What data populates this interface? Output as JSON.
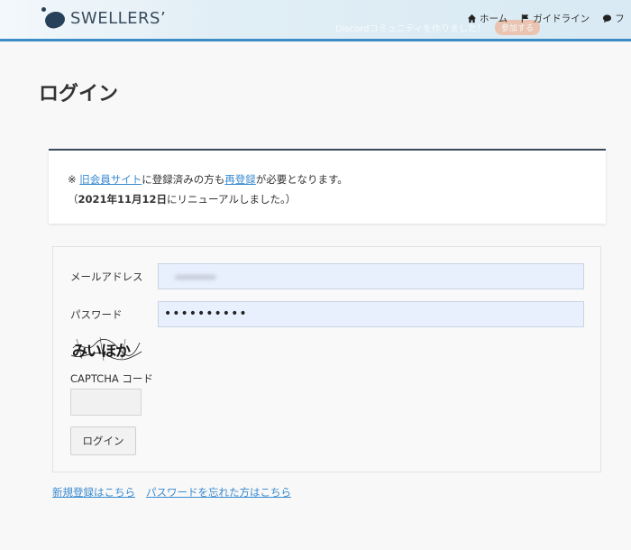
{
  "header": {
    "logo_text": "SWELLERS’",
    "banner_text": "Discordコミュニティを作りました！",
    "banner_button": "参加する",
    "nav": [
      {
        "label": "ホーム",
        "icon": "home-icon"
      },
      {
        "label": "ガイドライン",
        "icon": "flag-icon"
      },
      {
        "label": "フ",
        "icon": "speech-bubble-icon"
      }
    ],
    "accent_color": "#3c8cc8"
  },
  "page_title": "ログイン",
  "notice": {
    "prefix": "※ ",
    "link1": "旧会員サイト",
    "text1": "に登録済みの方も",
    "link2": "再登録",
    "text2": "が必要となります。",
    "line2_open": "（",
    "line2_bold": "2021年11月12日",
    "line2_rest": "にリニューアルしました。）"
  },
  "form": {
    "email_label": "メールアドレス",
    "password_label": "パスワード",
    "password_value": "••••••••••",
    "captcha_label": "CAPTCHA コード",
    "captcha_text": "みいほか",
    "login_button": "ログイン"
  },
  "links": {
    "register": "新規登録はこちら",
    "forgot_password": "パスワードを忘れた方はこちら"
  }
}
